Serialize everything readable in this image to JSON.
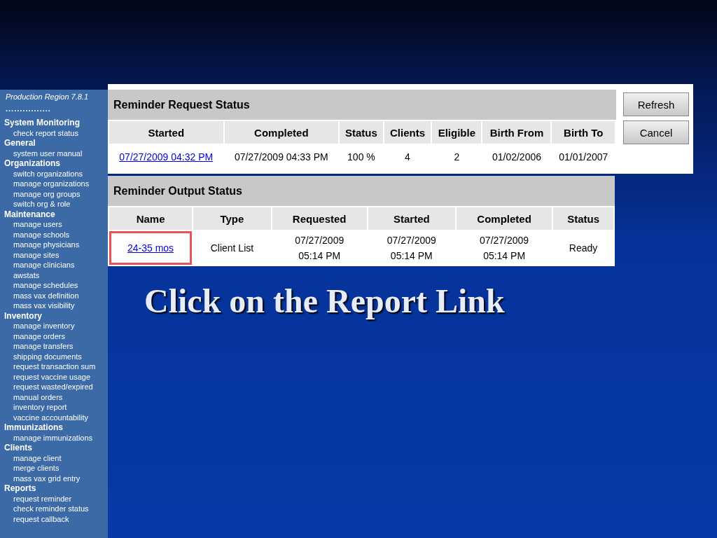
{
  "sidebar": {
    "title": "Production Region 7.8.1",
    "separator": "................",
    "sections": [
      {
        "label": "System Monitoring",
        "items": [
          "check report status"
        ]
      },
      {
        "label": "General",
        "items": [
          "system user manual"
        ]
      },
      {
        "label": "Organizations",
        "items": [
          "switch organizations",
          "manage organizations",
          "manage org groups",
          "switch org & role"
        ]
      },
      {
        "label": "Maintenance",
        "items": [
          "manage users",
          "manage schools",
          "manage physicians",
          "manage sites",
          "manage clinicians",
          "awstats",
          "manage schedules",
          "mass vax definition",
          "mass vax visibility"
        ]
      },
      {
        "label": "Inventory",
        "items": [
          "manage inventory",
          "manage orders",
          "manage transfers",
          "shipping documents",
          "request transaction sum",
          "request vaccine usage",
          "request wasted/expired",
          "manual orders",
          "inventory report",
          "vaccine accountability"
        ]
      },
      {
        "label": "Immunizations",
        "items": [
          "manage immunizations"
        ]
      },
      {
        "label": "Clients",
        "items": [
          "manage client",
          "merge clients",
          "mass vax grid entry"
        ]
      },
      {
        "label": "Reports",
        "items": [
          "request reminder",
          "check reminder status",
          "request callback"
        ]
      }
    ]
  },
  "request_status": {
    "title": "Reminder Request Status",
    "columns": [
      "Started",
      "Completed",
      "Status",
      "Clients",
      "Eligible",
      "Birth From",
      "Birth To"
    ],
    "rows": [
      {
        "cells": [
          "07/27/2009 04:32 PM",
          "07/27/2009 04:33 PM",
          "100 %",
          "4",
          "2",
          "01/02/2006",
          "01/01/2007"
        ],
        "highlighted": false
      }
    ]
  },
  "buttons": [
    "Refresh",
    "Cancel"
  ],
  "output_status": {
    "title": "Reminder Output Status",
    "columns": [
      "Name",
      "Type",
      "Requested",
      "Started",
      "Completed",
      "Status"
    ],
    "rows": [
      {
        "cells": [
          "24-35 mos",
          "Client List",
          "07/27/2009\n05:14 PM",
          "07/27/2009\n05:14 PM",
          "07/27/2009\n05:14 PM",
          "Ready"
        ],
        "highlighted": true
      }
    ]
  },
  "caption": "Click on the Report Link"
}
